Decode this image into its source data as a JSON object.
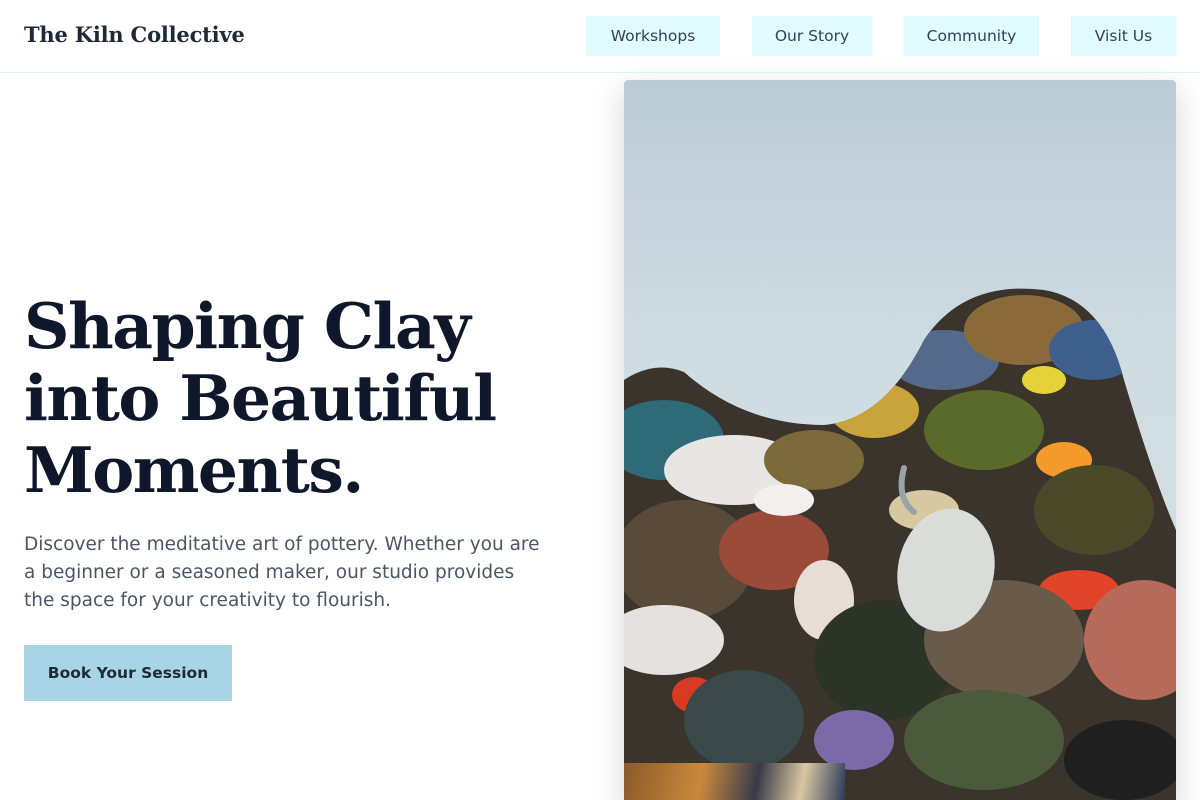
{
  "header": {
    "brand": "The Kiln Collective",
    "nav": [
      "Workshops",
      "Our Story",
      "Community",
      "Visit Us"
    ]
  },
  "hero": {
    "title_lines": [
      "Shaping Clay",
      "into Beautiful",
      "Moments."
    ],
    "description": "Discover the meditative art of pottery. Whether you are a beginner or a seasoned maker, our studio provides the space for your creativity to flourish.",
    "cta_label": "Book Your Session"
  },
  "colors": {
    "nav_button_bg": "#e0fbfd",
    "cta_bg": "#a8d5e5",
    "title_text": "#0f172a",
    "body_text": "#4b5563"
  }
}
